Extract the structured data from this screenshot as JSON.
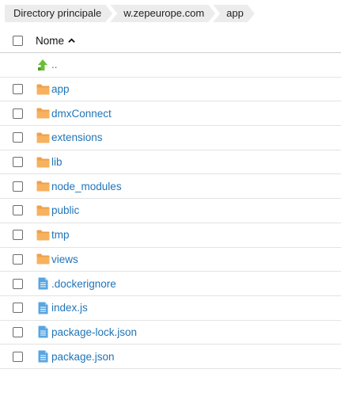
{
  "breadcrumb": [
    {
      "label": "Directory principale"
    },
    {
      "label": "w.zepeurope.com"
    },
    {
      "label": "app"
    }
  ],
  "header": {
    "name_label": "Nome",
    "sort_direction": "ascending"
  },
  "parent": {
    "label": ".."
  },
  "items": [
    {
      "name": "app",
      "type": "folder"
    },
    {
      "name": "dmxConnect",
      "type": "folder"
    },
    {
      "name": "extensions",
      "type": "folder"
    },
    {
      "name": "lib",
      "type": "folder"
    },
    {
      "name": "node_modules",
      "type": "folder"
    },
    {
      "name": "public",
      "type": "folder"
    },
    {
      "name": "tmp",
      "type": "folder"
    },
    {
      "name": "views",
      "type": "folder"
    },
    {
      "name": ".dockerignore",
      "type": "file"
    },
    {
      "name": "index.js",
      "type": "file"
    },
    {
      "name": "package-lock.json",
      "type": "file"
    },
    {
      "name": "package.json",
      "type": "file"
    }
  ],
  "colors": {
    "link": "#1f74b8",
    "folder": "#f0a04a",
    "file": "#5aa5e0",
    "up_arrow": "#6abf3a"
  }
}
